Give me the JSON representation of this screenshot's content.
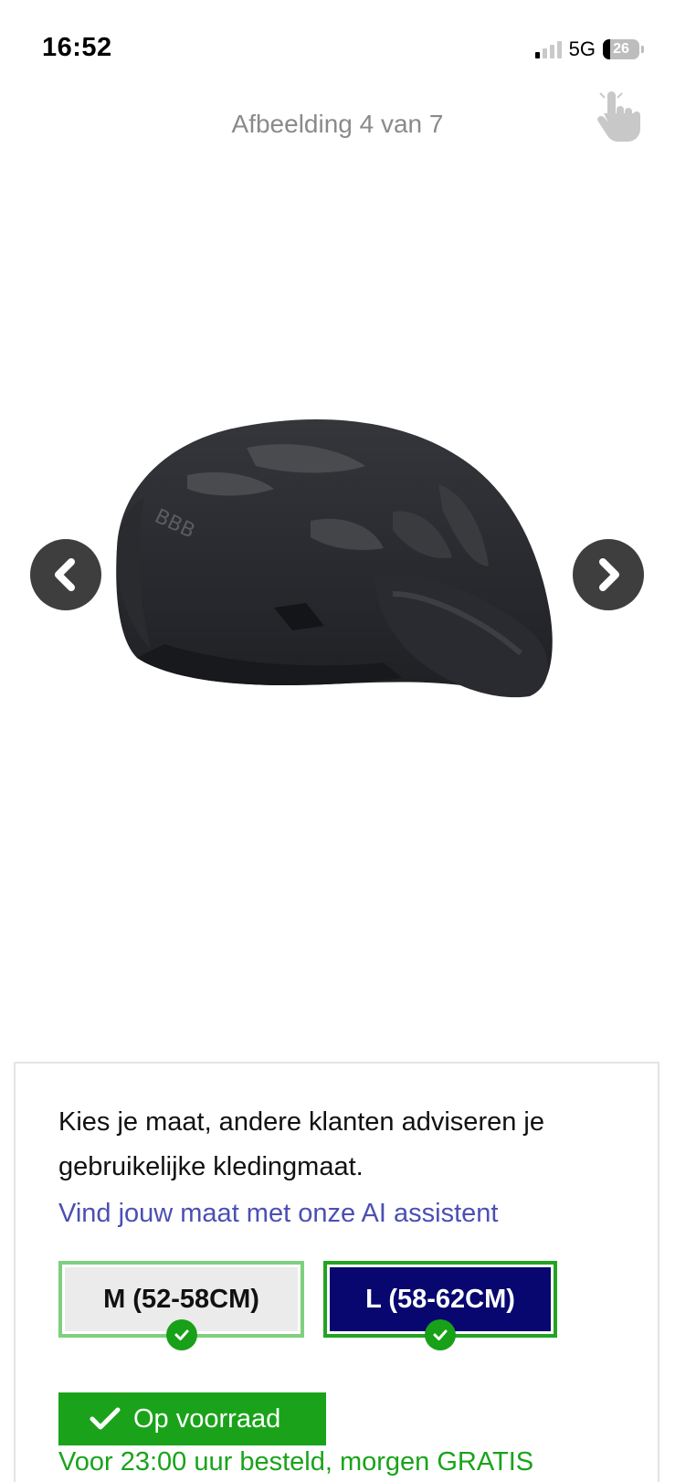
{
  "status_bar": {
    "time": "16:52",
    "network": "5G",
    "battery": "26"
  },
  "gallery": {
    "caption": "Afbeelding 4 van 7",
    "icons": [
      "swipe-hand-icon",
      "chevron-left-icon",
      "chevron-right-icon"
    ]
  },
  "product": {
    "image_brand_mark": "BBB"
  },
  "size_selector": {
    "intro": "Kies je maat, andere klanten adviseren je gebruikelijke kledingmaat.",
    "ai_link": "Vind jouw maat met onze AI assistent",
    "sizes": [
      {
        "label": "M (52-58CM)",
        "available": true,
        "selected": false
      },
      {
        "label": "L (58-62CM)",
        "available": true,
        "selected": true
      }
    ]
  },
  "stock": {
    "label": "Op voorraad",
    "delivery_text": "Voor 23:00 uur besteld, morgen GRATIS"
  },
  "colors": {
    "selected_size_bg": "#07076F",
    "available_green": "#1AA31A",
    "link": "#4B4FB3",
    "nav_button": "#3E3E3E"
  }
}
